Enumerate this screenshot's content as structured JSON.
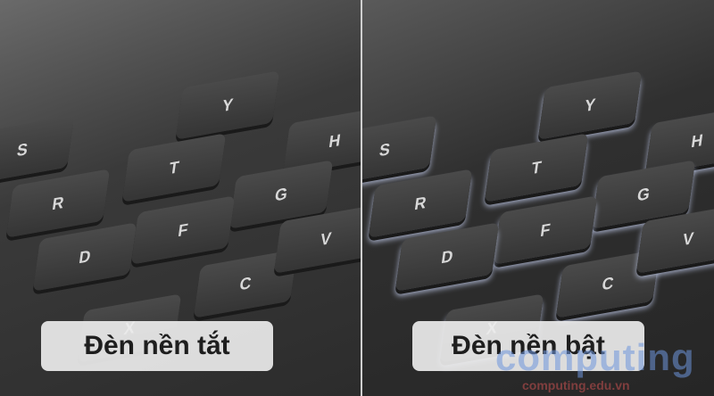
{
  "keys": [
    "S",
    "Y",
    "H",
    "R",
    "T",
    "G",
    "F",
    "D",
    "C",
    "V",
    "X"
  ],
  "labels": {
    "off": "Đèn nền tắt",
    "on": "Đèn nền bật"
  },
  "watermark": {
    "brand": "computing",
    "url": "computing.edu.vn"
  }
}
